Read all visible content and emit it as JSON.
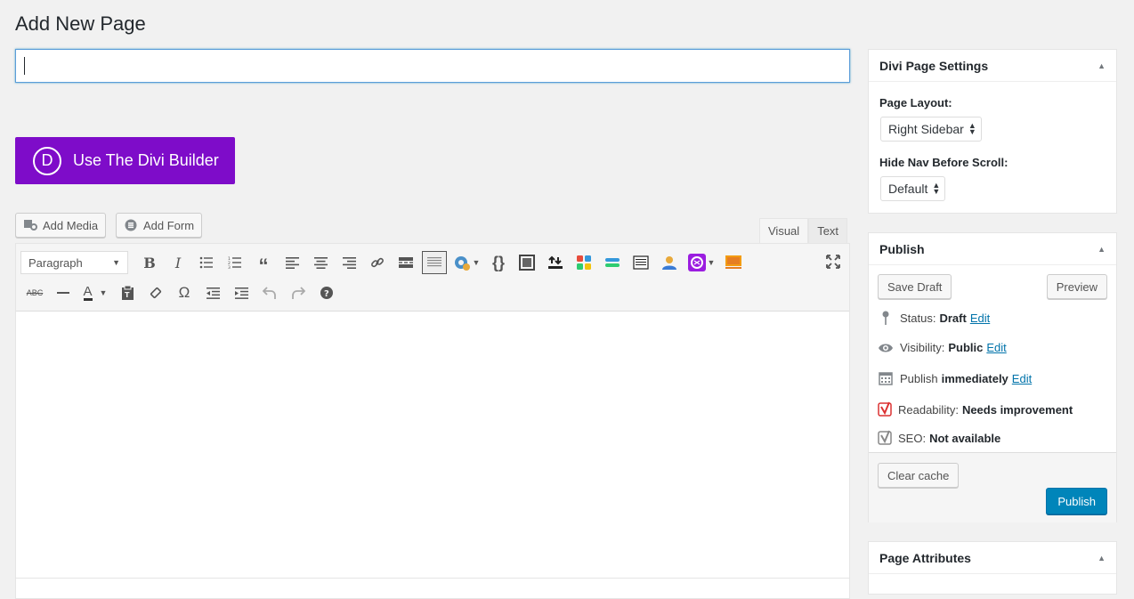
{
  "page": {
    "title": "Add New Page"
  },
  "title_input": {
    "value": ""
  },
  "divi_builder": {
    "logo_letter": "D",
    "label": "Use The Divi Builder",
    "color": "#7e0cc9"
  },
  "media_buttons": {
    "add_media": "Add Media",
    "add_form": "Add Form"
  },
  "editor_tabs": {
    "visual": "Visual",
    "text": "Text",
    "active": "Visual"
  },
  "toolbar": {
    "format_select": "Paragraph",
    "row1_icons": [
      "bold-icon",
      "italic-icon",
      "bullet-list-icon",
      "numbered-list-icon",
      "blockquote-icon",
      "align-left-icon",
      "align-center-icon",
      "align-right-icon",
      "link-icon",
      "read-more-icon",
      "toolbar-toggle-icon",
      "shortcode-gear-icon",
      "code-braces-icon",
      "image-frame-icon",
      "upload-icon",
      "color-grid-icon",
      "layout-bars-icon",
      "table-icon",
      "user-icon",
      "plugin-icon",
      "slideshow-icon"
    ],
    "row2_icons": [
      "strikethrough-icon",
      "horizontal-line-icon",
      "text-color-icon",
      "paste-text-icon",
      "clear-format-icon",
      "special-char-icon",
      "outdent-icon",
      "indent-icon",
      "undo-icon",
      "redo-icon",
      "help-icon"
    ],
    "fullscreen_icon": "fullscreen-icon"
  },
  "divi_settings": {
    "title": "Divi Page Settings",
    "page_layout_label": "Page Layout:",
    "page_layout_value": "Right Sidebar",
    "hide_nav_label": "Hide Nav Before Scroll:",
    "hide_nav_value": "Default"
  },
  "publish": {
    "title": "Publish",
    "save_draft": "Save Draft",
    "preview": "Preview",
    "status_label": "Status:",
    "status_value": "Draft",
    "visibility_label": "Visibility:",
    "visibility_value": "Public",
    "publish_label": "Publish",
    "publish_value": "immediately",
    "edit": "Edit",
    "readability_label": "Readability:",
    "readability_value": "Needs improvement",
    "seo_label": "SEO:",
    "seo_value": "Not available",
    "clear_cache": "Clear cache",
    "publish_button": "Publish",
    "primary_color": "#0085ba"
  },
  "page_attributes": {
    "title": "Page Attributes"
  }
}
